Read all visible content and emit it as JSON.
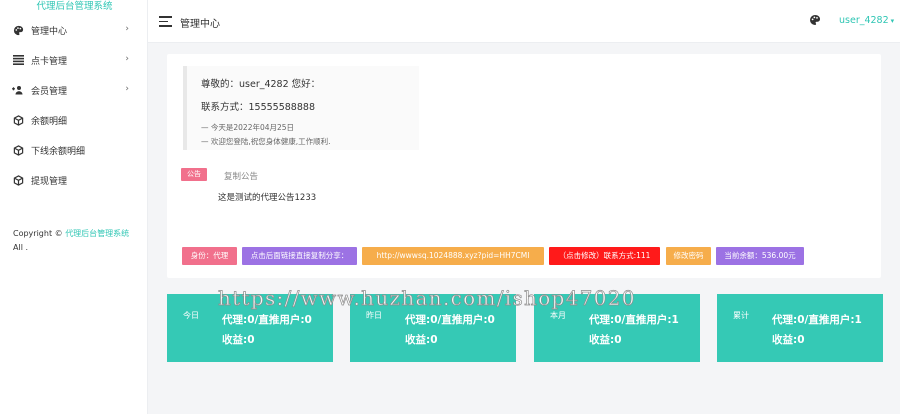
{
  "app": {
    "brand": "代理后台管理系统"
  },
  "sidebar": {
    "items": [
      {
        "label": "管理中心",
        "icon": "palette-icon",
        "has_submenu": true
      },
      {
        "label": "点卡管理",
        "icon": "list-icon",
        "has_submenu": true
      },
      {
        "label": "会员管理",
        "icon": "users-icon",
        "has_submenu": true
      },
      {
        "label": "余额明细",
        "icon": "box-icon",
        "has_submenu": false
      },
      {
        "label": "下线余额明细",
        "icon": "box-icon",
        "has_submenu": false
      },
      {
        "label": "提现管理",
        "icon": "box-icon",
        "has_submenu": false
      }
    ],
    "copyright_prefix": "Copyright © ",
    "copyright_link": "代理后台管理系统",
    "copyright_suffix": "All ."
  },
  "header": {
    "title": "管理中心",
    "username": "user_4282",
    "caret": "▾"
  },
  "welcome": {
    "greeting": "尊敬的：user_4282 您好：",
    "contact": "联系方式：15555588888",
    "date_note": "— 今天是2022年04月25日",
    "wish_note": "— 欢迎您登陆,祝您身体健康,工作顺利."
  },
  "notice": {
    "badge": "公告",
    "copy_label": "复制公告",
    "text": "这是测试的代理公告1233"
  },
  "tags": [
    {
      "label": "身份：代理",
      "color": "#f1708c"
    },
    {
      "label": "点击后面链接直接复制分享：",
      "color": "#9c72e4"
    },
    {
      "label": "http://wwwsq.1024888.xyz?pid=HH7CMI",
      "color": "#f6ad4b"
    },
    {
      "label": "（点击修改）联系方式:111",
      "color": "#ff1a1a"
    },
    {
      "label": "修改密码",
      "color": "#f6ad4b"
    },
    {
      "label": "当前余额：536.00元",
      "color": "#9c72e4"
    }
  ],
  "stats": [
    {
      "label": "今日",
      "line1": "代理:0/直推用户:0",
      "line2": "收益:0"
    },
    {
      "label": "昨日",
      "line1": "代理:0/直推用户:0",
      "line2": "收益:0"
    },
    {
      "label": "本月",
      "line1": "代理:0/直推用户:1",
      "line2": "收益:0"
    },
    {
      "label": "累计",
      "line1": "代理:0/直推用户:1",
      "line2": "收益:0"
    }
  ],
  "watermark": "https://www.huzhan.com/ishop47020",
  "colors": {
    "accent": "#2fc6b4",
    "stat_bg": "#35c9b5",
    "badge": "#f1708c"
  }
}
